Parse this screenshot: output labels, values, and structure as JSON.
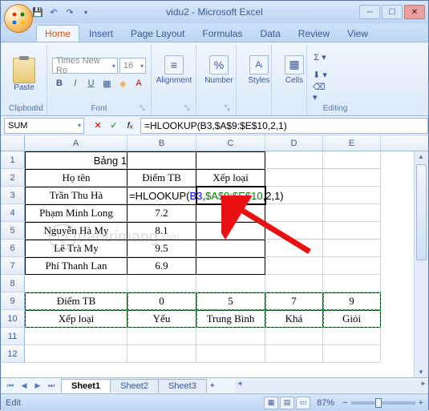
{
  "title": "vidu2 - Microsoft Excel",
  "tabs": [
    "Home",
    "Insert",
    "Page Layout",
    "Formulas",
    "Data",
    "Review",
    "View"
  ],
  "ribbon": {
    "paste": "Paste",
    "clipboard": "Clipboard",
    "font_group": "Font",
    "font_name": "Times New Ro",
    "font_size": "16",
    "alignment": "Alignment",
    "number": "Number",
    "styles": "Styles",
    "cells": "Cells",
    "editing": "Editing"
  },
  "namebox": "SUM",
  "formula": "=HLOOKUP(B3,$A$9:$E$10,2,1)",
  "cols": [
    "A",
    "B",
    "C",
    "D",
    "E"
  ],
  "cells": {
    "A1": "Bảng 1",
    "A2": "Họ tên",
    "B2": "Điểm TB",
    "C2": "Xếp loại",
    "A3": "Trần Thu Hà",
    "A4": "Phạm Minh Long",
    "B4": "7.2",
    "A5": "Nguyễn Hà My",
    "B5": "8.1",
    "A6": "Lê Trà My",
    "B6": "9.5",
    "A7": "Phí Thanh Lan",
    "B7": "6.9",
    "A9": "Điểm TB",
    "B9": "0",
    "C9": "5",
    "D9": "7",
    "E9": "9",
    "A10": "Xếp loại",
    "B10": "Yếu",
    "C10": "Trung Bình",
    "D10": "Khá",
    "E10": "Giỏi"
  },
  "formula_display": {
    "prefix": "=HLOOKUP(",
    "ref1": "B3",
    "sep1": ",",
    "ref2": "$A$9:$E$10",
    "suffix": ",2,1)"
  },
  "sheets": [
    "Sheet1",
    "Sheet2",
    "Sheet3"
  ],
  "status": "Edit",
  "zoom": "87%",
  "watermark": "uantrimang"
}
